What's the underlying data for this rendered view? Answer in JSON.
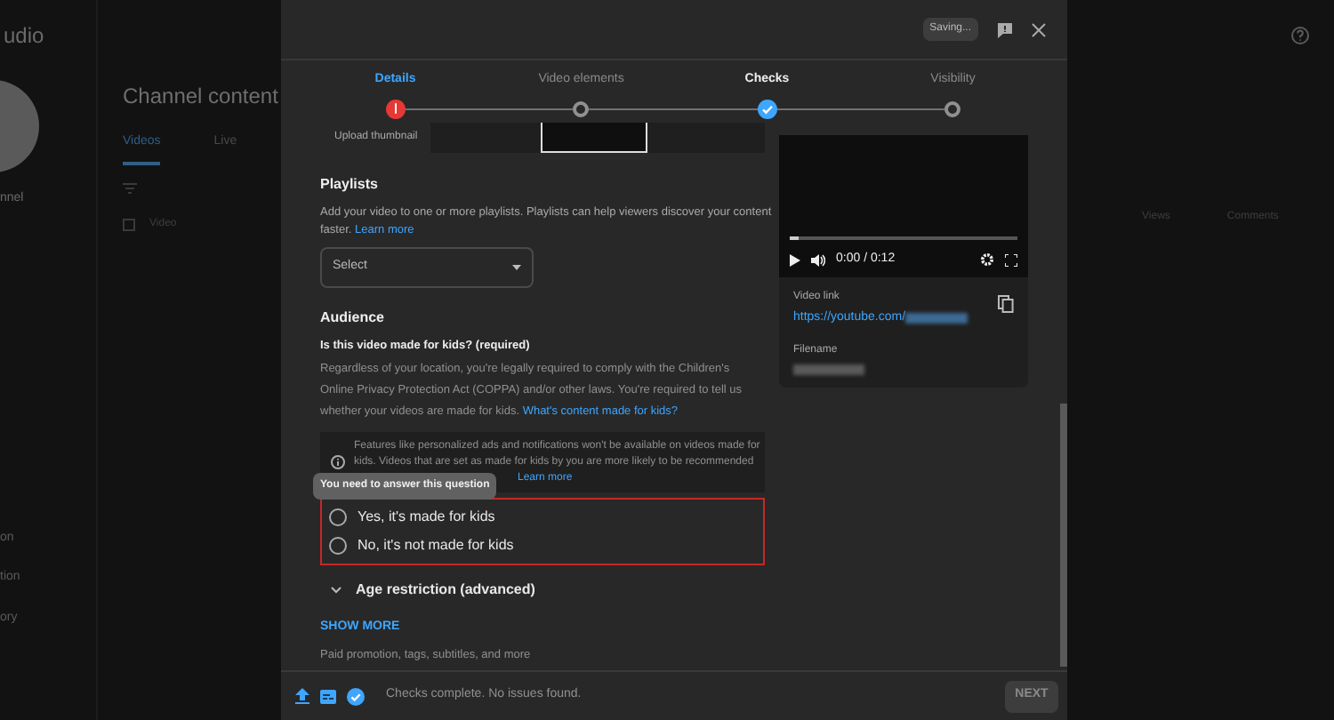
{
  "background": {
    "app_title": "udio",
    "channel_name": "nnel",
    "page_title": "Channel content",
    "tabs": [
      {
        "label": "Videos",
        "selected": true
      },
      {
        "label": "Live",
        "selected": false
      }
    ],
    "sidebar_items": [
      "on",
      "tion",
      "ory"
    ],
    "table_columns": [
      "Video",
      "Views",
      "Comments"
    ],
    "select_all_checked": false
  },
  "dialog": {
    "status_badge": "Saving...",
    "steps": [
      {
        "label": "Details",
        "kind": "error",
        "selected": true
      },
      {
        "label": "Video elements",
        "kind": "pending",
        "selected": false
      },
      {
        "label": "Checks",
        "kind": "done",
        "selected": false
      },
      {
        "label": "Visibility",
        "kind": "pending",
        "selected": false
      }
    ],
    "thumbnail_label": "Upload thumbnail",
    "playlists": {
      "title": "Playlists",
      "description": "Add your video to one or more playlists. Playlists can help viewers discover your content faster.",
      "link": "Learn more",
      "dropdown": "Select"
    },
    "audience": {
      "title": "Audience",
      "question": "Is this video made for kids? (required)",
      "description": "Regardless of your location, you're legally required to comply with the Children's Online Privacy Protection Act (COPPA) and/or other laws. You're required to tell us whether your videos are made for kids.",
      "link": "What's content made for kids?",
      "notice": "Features like personalized ads and notifications won't be available on videos made for kids. Videos that are set as made for kids by you are more likely to be recommended",
      "notice_link": "Learn more",
      "tooltip": "You need to answer this question",
      "error": true,
      "options": [
        {
          "label": "Yes, it's made for kids",
          "selected": false
        },
        {
          "label": "No, it's not made for kids",
          "selected": false
        }
      ]
    },
    "age_restriction": {
      "label": "Age restriction (advanced)",
      "expanded": false
    },
    "show_more": "SHOW MORE",
    "show_more_hint": "Paid promotion, tags, subtitles, and more",
    "preview": {
      "time": "0:00 / 0:12",
      "level": 0.04,
      "link_label": "Video link",
      "link": "https://youtube.com/",
      "filename_label": "Filename"
    },
    "footer": {
      "status": "Checks complete. No issues found.",
      "next": {
        "label": "NEXT",
        "disabled": true
      }
    }
  }
}
